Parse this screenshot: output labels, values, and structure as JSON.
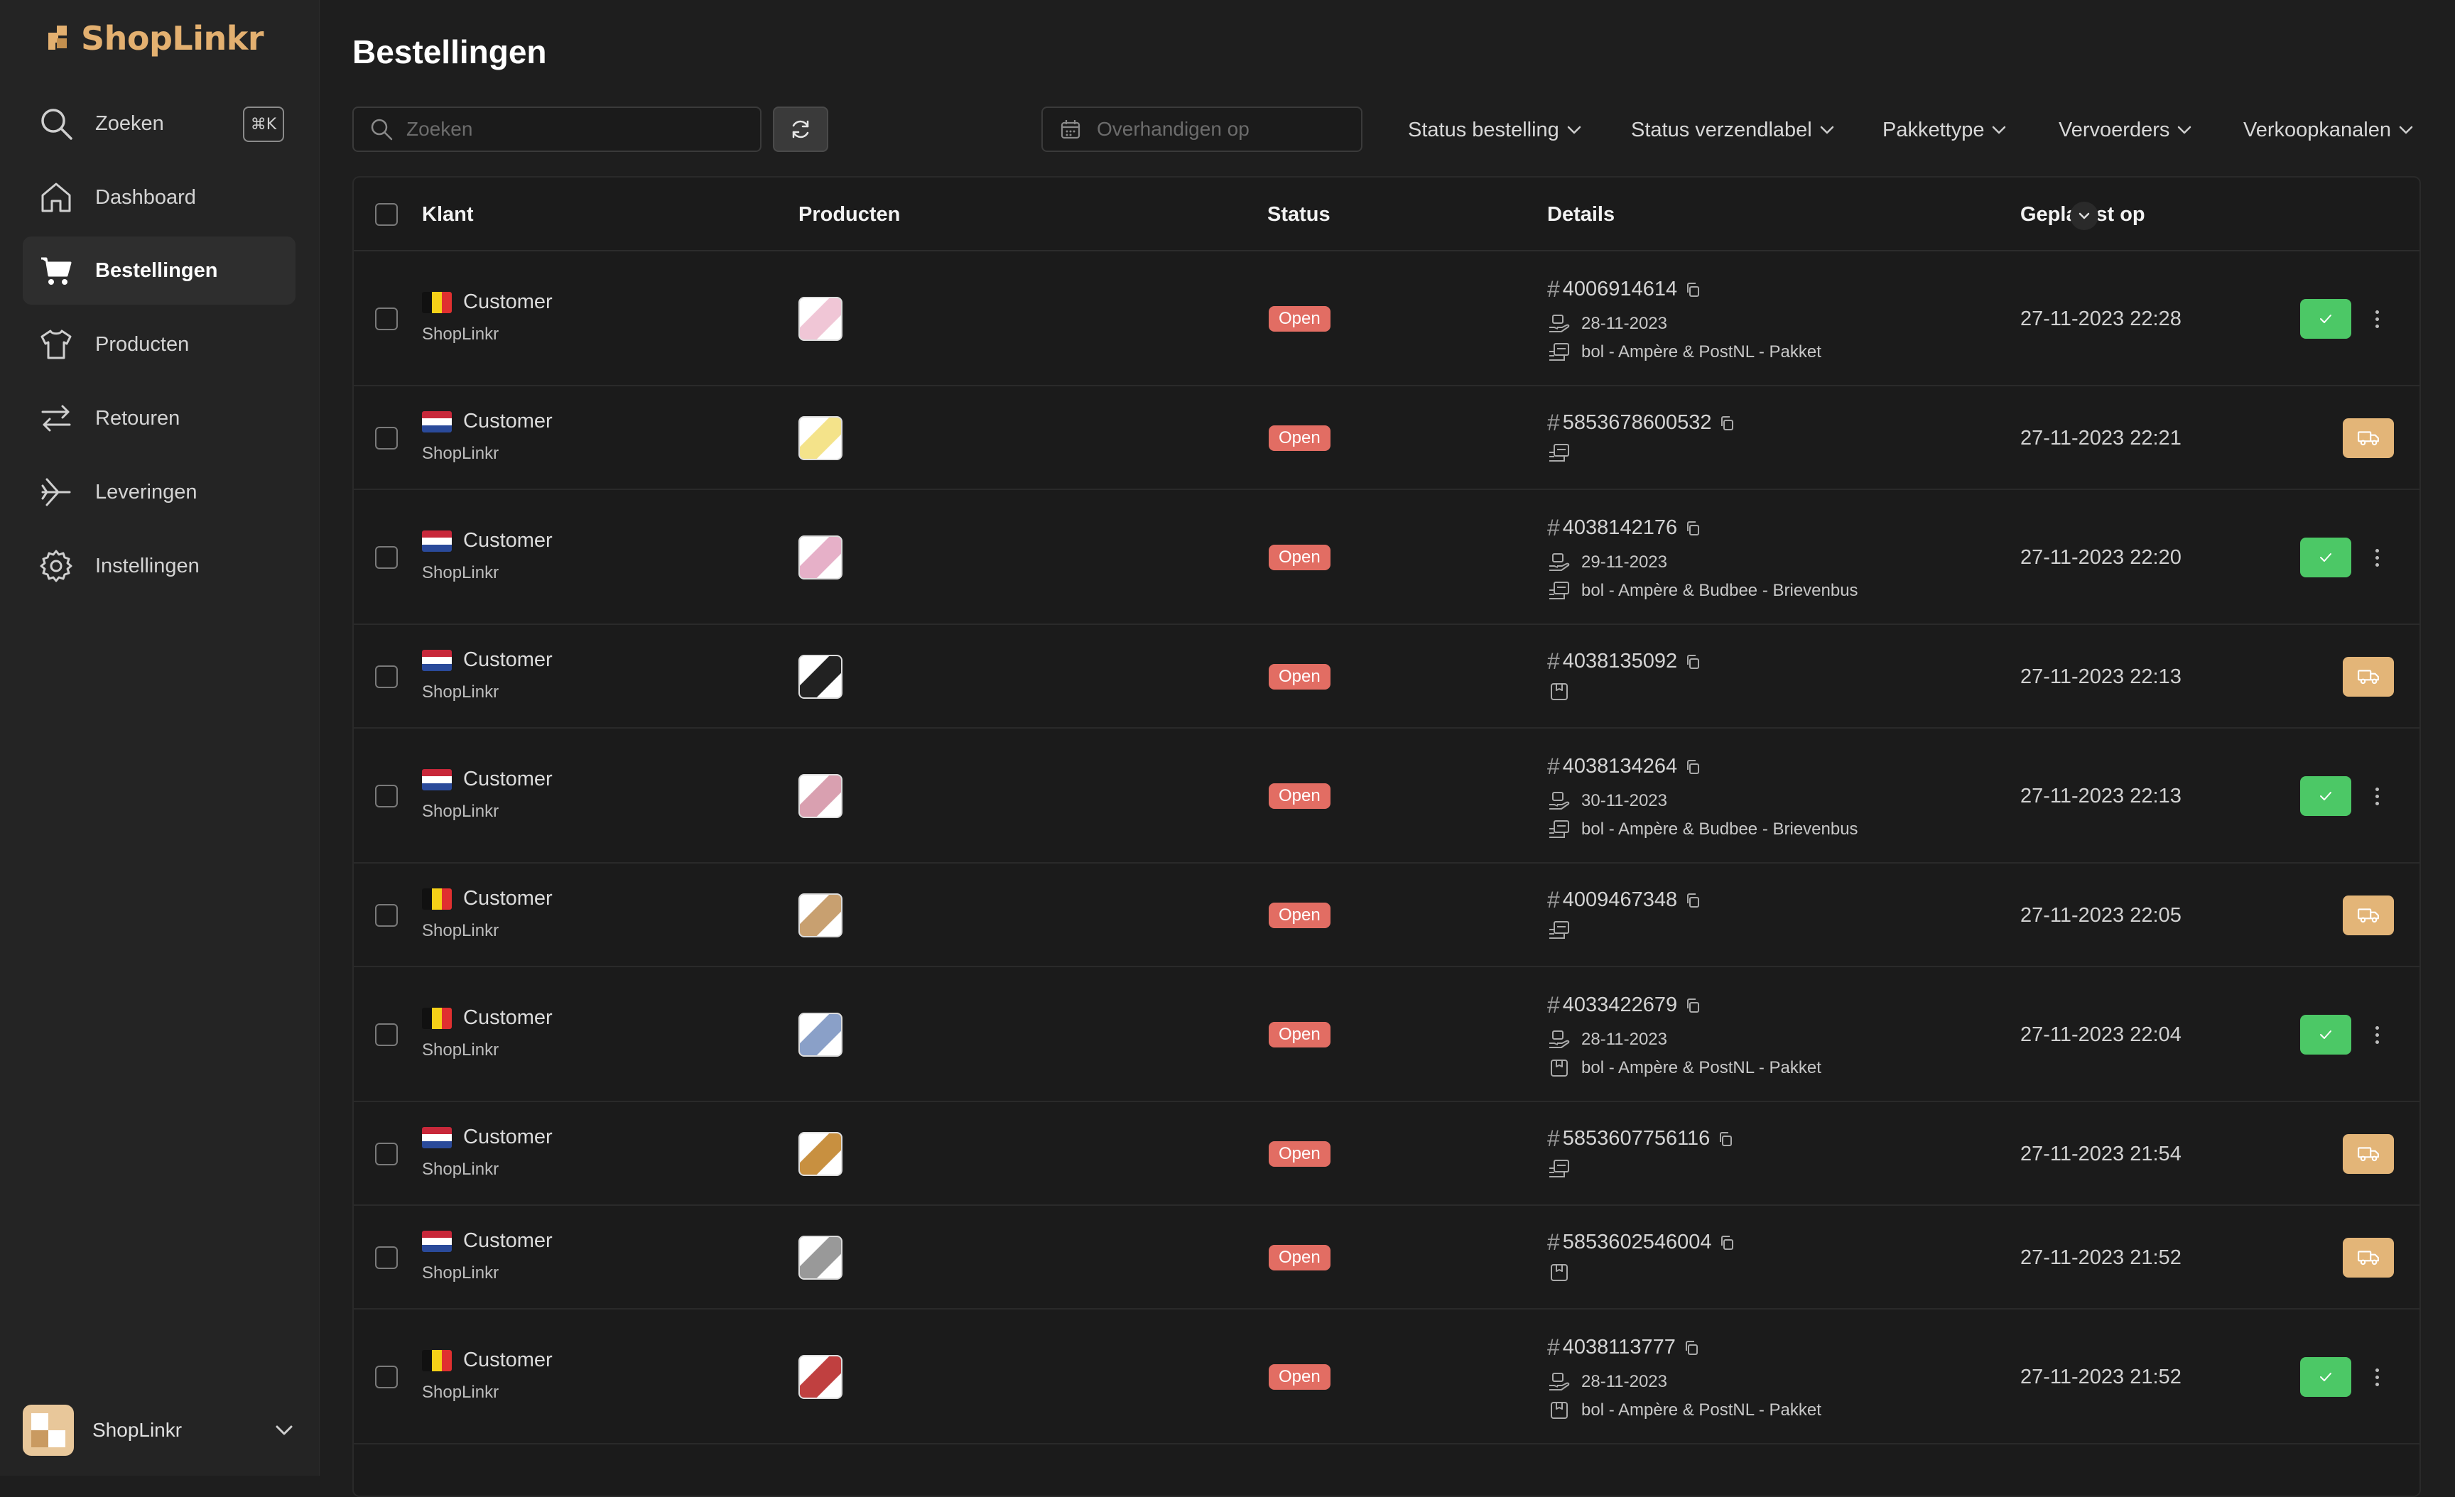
{
  "app": {
    "name": "ShopLinkr"
  },
  "sidebar": {
    "search_label": "Zoeken",
    "search_shortcut": "⌘K",
    "items": [
      {
        "label": "Dashboard",
        "icon": "home-icon",
        "active": false
      },
      {
        "label": "Bestellingen",
        "icon": "cart-icon",
        "active": true
      },
      {
        "label": "Producten",
        "icon": "shirt-icon",
        "active": false
      },
      {
        "label": "Retouren",
        "icon": "arrows-icon",
        "active": false
      },
      {
        "label": "Leveringen",
        "icon": "plane-icon",
        "active": false
      },
      {
        "label": "Instellingen",
        "icon": "gear-icon",
        "active": false
      }
    ],
    "org_name": "ShopLinkr"
  },
  "page": {
    "title": "Bestellingen"
  },
  "toolbar": {
    "search_placeholder": "Zoeken",
    "date_placeholder": "Overhandigen op",
    "filters": [
      "Status bestelling",
      "Status verzendlabel",
      "Pakkettype",
      "Vervoerders",
      "Verkoopkanalen"
    ]
  },
  "table": {
    "columns": [
      "Klant",
      "Producten",
      "Status",
      "Details",
      "Geplaatst op"
    ],
    "rows": [
      {
        "flag": "be",
        "customer": "Customer",
        "shop": "ShopLinkr",
        "status": "Open",
        "order": "4006914614",
        "date": "28-11-2023",
        "carrier": "bol - Ampère & PostNL - Pakket",
        "placed": "27-11-2023 22:28",
        "action": "green"
      },
      {
        "flag": "nl",
        "customer": "Customer",
        "shop": "ShopLinkr",
        "status": "Open",
        "order": "5853678600532",
        "date": "",
        "carrier": "",
        "placed": "27-11-2023 22:21",
        "action": "amber"
      },
      {
        "flag": "nl",
        "customer": "Customer",
        "shop": "ShopLinkr",
        "status": "Open",
        "order": "4038142176",
        "date": "29-11-2023",
        "carrier": "bol - Ampère & Budbee - Brievenbus",
        "placed": "27-11-2023 22:20",
        "action": "green"
      },
      {
        "flag": "nl",
        "customer": "Customer",
        "shop": "ShopLinkr",
        "status": "Open",
        "order": "4038135092",
        "date": "",
        "carrier": "",
        "placed": "27-11-2023 22:13",
        "action": "amber"
      },
      {
        "flag": "nl",
        "customer": "Customer",
        "shop": "ShopLinkr",
        "status": "Open",
        "order": "4038134264",
        "date": "30-11-2023",
        "carrier": "bol - Ampère & Budbee - Brievenbus",
        "placed": "27-11-2023 22:13",
        "action": "green"
      },
      {
        "flag": "be",
        "customer": "Customer",
        "shop": "ShopLinkr",
        "status": "Open",
        "order": "4009467348",
        "date": "",
        "carrier": "",
        "placed": "27-11-2023 22:05",
        "action": "amber"
      },
      {
        "flag": "be",
        "customer": "Customer",
        "shop": "ShopLinkr",
        "status": "Open",
        "order": "4033422679",
        "date": "28-11-2023",
        "carrier": "bol - Ampère & PostNL - Pakket",
        "placed": "27-11-2023 22:04",
        "action": "green"
      },
      {
        "flag": "nl",
        "customer": "Customer",
        "shop": "ShopLinkr",
        "status": "Open",
        "order": "5853607756116",
        "date": "",
        "carrier": "",
        "placed": "27-11-2023 21:54",
        "action": "amber"
      },
      {
        "flag": "nl",
        "customer": "Customer",
        "shop": "ShopLinkr",
        "status": "Open",
        "order": "5853602546004",
        "date": "",
        "carrier": "",
        "placed": "27-11-2023 21:52",
        "action": "amber"
      },
      {
        "flag": "be",
        "customer": "Customer",
        "shop": "ShopLinkr",
        "status": "Open",
        "order": "4038113777",
        "date": "28-11-2023",
        "carrier": "bol - Ampère & PostNL - Pakket",
        "placed": "27-11-2023 21:52",
        "action": "green"
      }
    ]
  },
  "colors": {
    "accent": "#e3b070",
    "status_open": "#e26d63",
    "action_green": "#4cc866",
    "action_amber": "#e3b578"
  }
}
